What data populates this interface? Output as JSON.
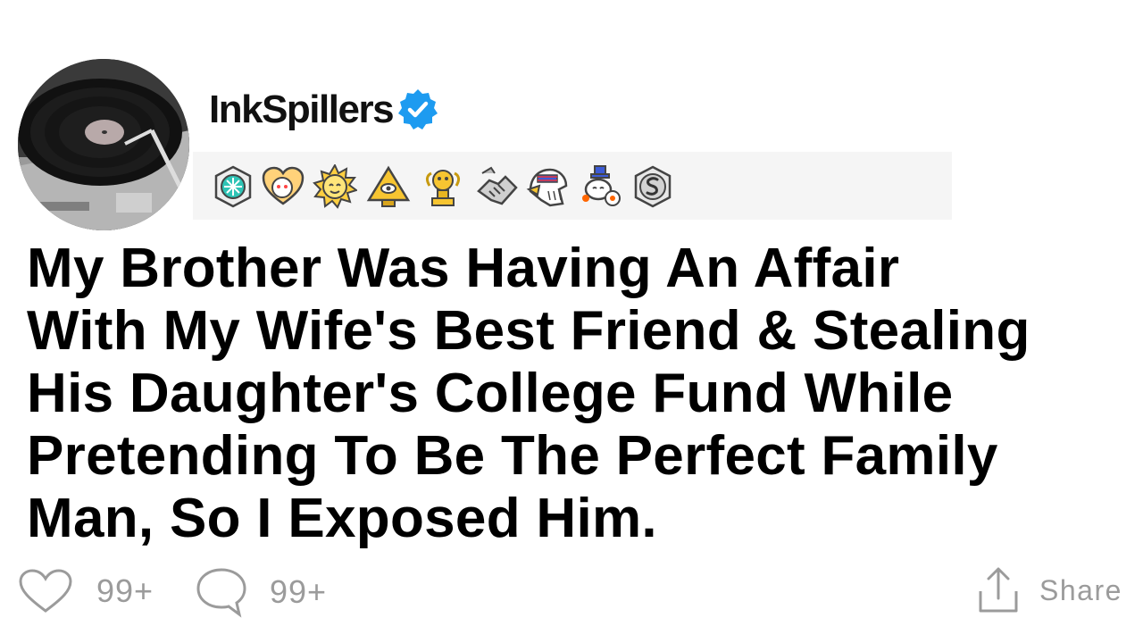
{
  "post": {
    "username": "InkSpillers",
    "verified": true,
    "title_lines": [
      "My Brother Was Having An Affair",
      "With My Wife's Best Friend & Stealing",
      "His Daughter's College Fund While",
      "Pretending To Be The Perfect Family",
      "Man, So I Exposed Him."
    ]
  },
  "awards": [
    {
      "name": "helpful-award-icon"
    },
    {
      "name": "wholesome-award-icon"
    },
    {
      "name": "sun-award-icon"
    },
    {
      "name": "pyramid-eye-award-icon"
    },
    {
      "name": "gold-trophy-award-icon"
    },
    {
      "name": "handshake-award-icon"
    },
    {
      "name": "eagle-award-icon"
    },
    {
      "name": "snoo-hat-award-icon"
    },
    {
      "name": "silver-award-icon"
    }
  ],
  "actions": {
    "likes": "99+",
    "comments": "99+",
    "share_label": "Share"
  },
  "colors": {
    "verified_blue": "#1d9bf0",
    "muted_text": "#9b9b9b",
    "awards_bar_bg": "#f5f5f5"
  }
}
